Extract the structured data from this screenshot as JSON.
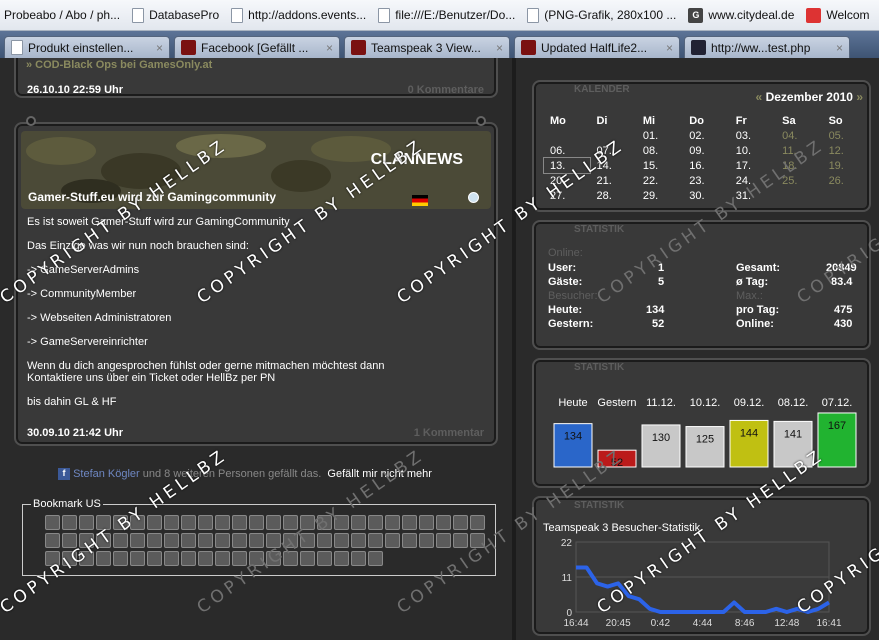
{
  "bookmarks": [
    {
      "label": "Probeabo / Abo / ph...",
      "icon": "page-icon"
    },
    {
      "label": "DatabasePro",
      "icon": "page-icon"
    },
    {
      "label": "http://addons.events...",
      "icon": "page-icon"
    },
    {
      "label": "file:///E:/Benutzer/Do...",
      "icon": "page-icon"
    },
    {
      "label": "(PNG-Grafik, 280x100 ...",
      "icon": "page-icon"
    },
    {
      "label": "www.citydeal.de",
      "icon": "citydeal-icon"
    },
    {
      "label": "Welcom",
      "icon": "welcome-icon"
    }
  ],
  "tabs": [
    {
      "label": "Produkt einstellen..."
    },
    {
      "label": "Facebook [Gefällt ..."
    },
    {
      "label": "Teamspeak 3 View..."
    },
    {
      "label": "Updated HalfLife2..."
    },
    {
      "label": "http://ww...test.php"
    }
  ],
  "prev_news": {
    "link": "» COD-Black Ops bei GamesOnly.at",
    "date": "26.10.10 22:59 Uhr",
    "comments": "0 Kommentare"
  },
  "news": {
    "banner": "CLANNEWS",
    "title": "Gamer-Stuff.eu wird zur Gamingcommunity",
    "lines": [
      "Es ist soweit Gamer-Stuff wird zur GamingCommunity",
      "",
      "Das Einzige was wir nun noch brauchen sind:",
      "",
      "-> GameServerAdmins",
      "",
      "-> CommunityMember",
      "",
      "-> Webseiten Administratoren",
      "",
      "-> GameServereinrichter",
      "",
      "Wenn du dich angesprochen fühlst oder gerne mitmachen möchtest dann",
      "Kontaktiere uns über ein Ticket oder HellBz per PN",
      "",
      "bis dahin GL & HF"
    ],
    "date": "30.09.10 21:42 Uhr",
    "comments": "1 Kommentar"
  },
  "facebook": {
    "name": "Stefan Kögler",
    "text": " und 8 weiteren Personen gefällt das.",
    "unlike": "Gefällt mir nicht mehr"
  },
  "bookmark_us": {
    "title": "Bookmark US"
  },
  "calendar": {
    "header": "KALENDER",
    "month": "Dezember 2010",
    "prev": "«",
    "next": "»",
    "days": [
      "Mo",
      "Di",
      "Mi",
      "Do",
      "Fr",
      "Sa",
      "So"
    ],
    "weeks": [
      [
        "",
        "",
        "01.",
        "02.",
        "03.",
        "04.",
        "05."
      ],
      [
        "06.",
        "07.",
        "08.",
        "09.",
        "10.",
        "11.",
        "12."
      ],
      [
        "13.",
        "14.",
        "15.",
        "16.",
        "17.",
        "18.",
        "19."
      ],
      [
        "20.",
        "21.",
        "22.",
        "23.",
        "24.",
        "25.",
        "26."
      ],
      [
        "27.",
        "28.",
        "29.",
        "30.",
        "31.",
        "",
        ""
      ]
    ]
  },
  "stats": {
    "header": "STATISTIK",
    "online_label": "Online:",
    "user_label": "User:",
    "user": "1",
    "gaeste_label": "Gäste:",
    "gaeste": "5",
    "besucher_label": "Besucher:",
    "heute_label": "Heute:",
    "heute": "134",
    "gestern_label": "Gestern:",
    "gestern": "52",
    "gesamt_label": "Gesamt:",
    "gesamt": "20849",
    "tag_label": "ø Tag:",
    "tag": "83.4",
    "max_label": "Max.:",
    "protag_label": "pro Tag:",
    "protag": "475",
    "maxonline_label": "Online:",
    "maxonline": "430"
  },
  "visitor_chart": {
    "header": "STATISTIK"
  },
  "ts_chart": {
    "header": "STATISTIK",
    "title": "Teamspeak 3 Besucher-Statistik"
  },
  "watermarks": {
    "text": "COPYRIGHT BY HELLBZ"
  },
  "chart_data": [
    {
      "type": "bar",
      "categories": [
        "Heute",
        "Gestern",
        "11.12.",
        "10.12.",
        "09.12.",
        "08.12.",
        "07.12."
      ],
      "values": [
        134,
        52,
        130,
        125,
        144,
        141,
        167
      ],
      "colors": [
        "#2a66c9",
        "#bb1a1a",
        "#c8c8c8",
        "#c8c8c8",
        "#c0c012",
        "#c8c8c8",
        "#21b330"
      ]
    },
    {
      "type": "line",
      "title": "Teamspeak 3 Besucher-Statistik",
      "x": [
        "16:44",
        "17:44",
        "18:45",
        "19:45",
        "20:45",
        "21:45",
        "22:45",
        "23:45",
        "0:42",
        "1:43",
        "2:44",
        "3:44",
        "4:44",
        "5:45",
        "6:45",
        "7:46",
        "8:46",
        "9:46",
        "10:47",
        "11:47",
        "12:48",
        "13:48",
        "14:46",
        "15:47",
        "16:41"
      ],
      "xticks": [
        "16:44",
        "20:45",
        "0:42",
        "4:44",
        "8:46",
        "12:48",
        "16:41"
      ],
      "yticks": [
        0,
        11,
        22
      ],
      "ylim": [
        0,
        22
      ],
      "values": [
        14,
        14,
        9,
        8,
        9,
        5,
        4,
        1,
        0,
        0,
        0,
        0,
        0,
        0,
        0,
        3,
        0,
        0,
        0,
        1,
        0,
        1,
        0,
        1,
        3
      ],
      "color": "#2c63e8"
    }
  ]
}
